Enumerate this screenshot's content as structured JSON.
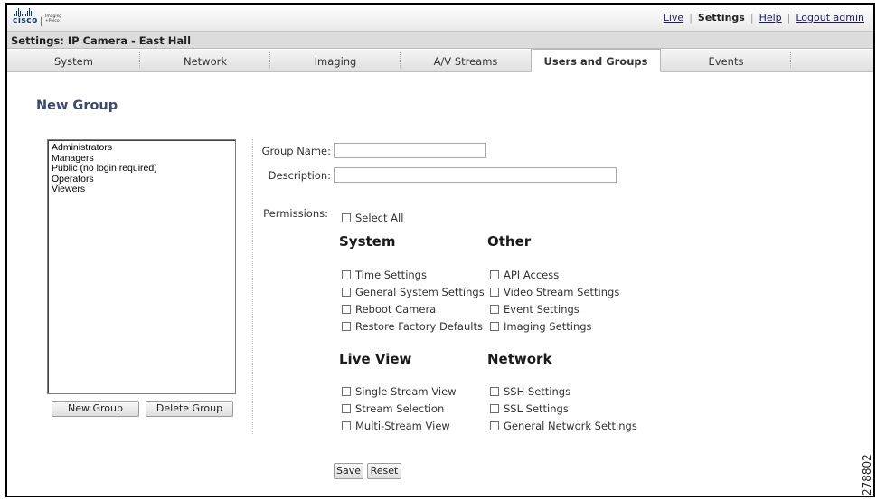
{
  "header": {
    "logo_word": "cisco",
    "logo_sub": [
      "Imaging",
      "+Pelco"
    ],
    "links": [
      {
        "label": "Live",
        "current": false
      },
      {
        "label": "Settings",
        "current": true
      },
      {
        "label": "Help",
        "current": false
      },
      {
        "label": "Logout admin",
        "current": false
      }
    ]
  },
  "title": "Settings: IP Camera - East Hall",
  "tabs": [
    {
      "label": "System"
    },
    {
      "label": "Network"
    },
    {
      "label": "Imaging"
    },
    {
      "label": "A/V Streams"
    },
    {
      "label": "Users and Groups",
      "active": true
    },
    {
      "label": "Events"
    }
  ],
  "page_heading": "New Group",
  "groups": [
    "Administrators",
    "Managers",
    "Public (no login required)",
    "Operators",
    "Viewers"
  ],
  "buttons": {
    "new_group": "New Group",
    "delete_group": "Delete Group",
    "save": "Save",
    "reset": "Reset"
  },
  "form": {
    "group_name_label": "Group Name:",
    "group_name_value": "",
    "description_label": "Description:",
    "description_value": "",
    "permissions_label": "Permissions:",
    "select_all": "Select All"
  },
  "sections": {
    "system": {
      "title": "System",
      "items": [
        "Time Settings",
        "General System Settings",
        "Reboot Camera",
        "Restore Factory Defaults"
      ]
    },
    "other": {
      "title": "Other",
      "items": [
        "API Access",
        "Video Stream Settings",
        "Event Settings",
        "Imaging Settings"
      ]
    },
    "live_view": {
      "title": "Live View",
      "items": [
        "Single Stream View",
        "Stream Selection",
        "Multi-Stream View"
      ]
    },
    "network": {
      "title": "Network",
      "items": [
        "SSH Settings",
        "SSL Settings",
        "General Network Settings"
      ]
    }
  },
  "side_code": "278802",
  "colors": {
    "heading": "#3c4a6e",
    "logo": "#0a3a74",
    "link": "#1a1a66"
  }
}
